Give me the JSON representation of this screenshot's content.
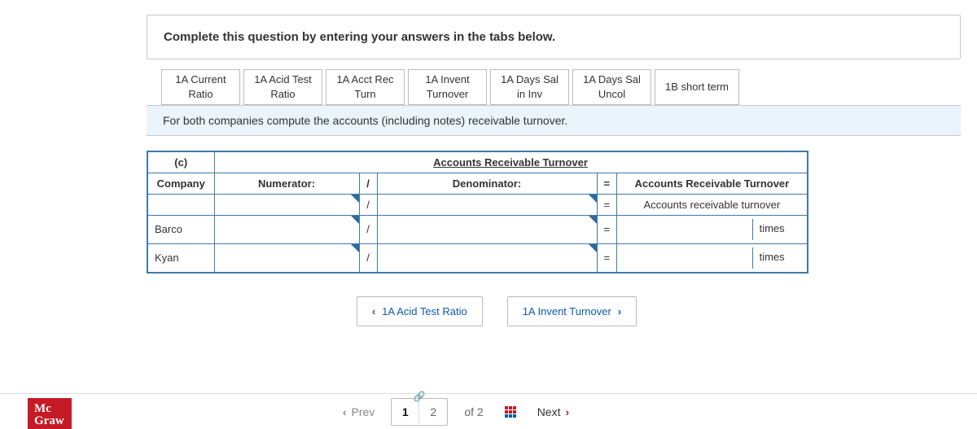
{
  "instruction": "Complete this question by entering your answers in the tabs below.",
  "tabs": [
    "1A Current Ratio",
    "1A Acid Test Ratio",
    "1A Acct Rec Turn",
    "1A Invent Turnover",
    "1A Days Sal in Inv",
    "1A Days Sal Uncol",
    "1B short term"
  ],
  "prompt": "For both companies compute the accounts (including notes) receivable turnover.",
  "table": {
    "corner": "(c)",
    "merged_header": "Accounts Receivable Turnover",
    "company_header": "Company",
    "numerator_header": "Numerator:",
    "slash": "/",
    "denominator_header": "Denominator:",
    "equals": "=",
    "result_header": "Accounts Receivable Turnover",
    "row_generic_result": "Accounts receivable turnover",
    "unit_label": "times",
    "rows": [
      {
        "company": "",
        "result_merged": true
      },
      {
        "company": "Barco",
        "result_merged": false
      },
      {
        "company": "Kyan",
        "result_merged": false
      }
    ]
  },
  "nav": {
    "prev_label": "1A Acid Test Ratio",
    "next_label": "1A Invent Turnover"
  },
  "footer": {
    "logo_line1": "Mc",
    "logo_line2": "Graw",
    "prev": "Prev",
    "next": "Next",
    "page_current": "1",
    "page_other": "2",
    "of": "of",
    "total": "2"
  }
}
